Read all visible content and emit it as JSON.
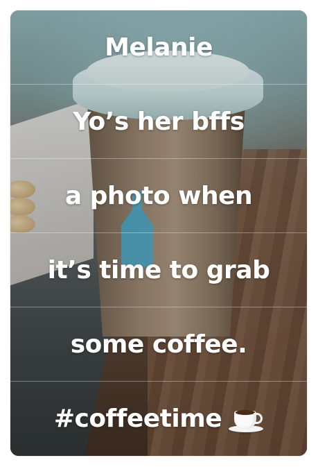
{
  "post": {
    "lines": [
      "Melanie",
      "Yo’s her bffs",
      "a photo when",
      "it’s time to grab",
      "some coffee.",
      "#coffeetime"
    ],
    "trailing_emoji": "coffee-cup-icon"
  }
}
